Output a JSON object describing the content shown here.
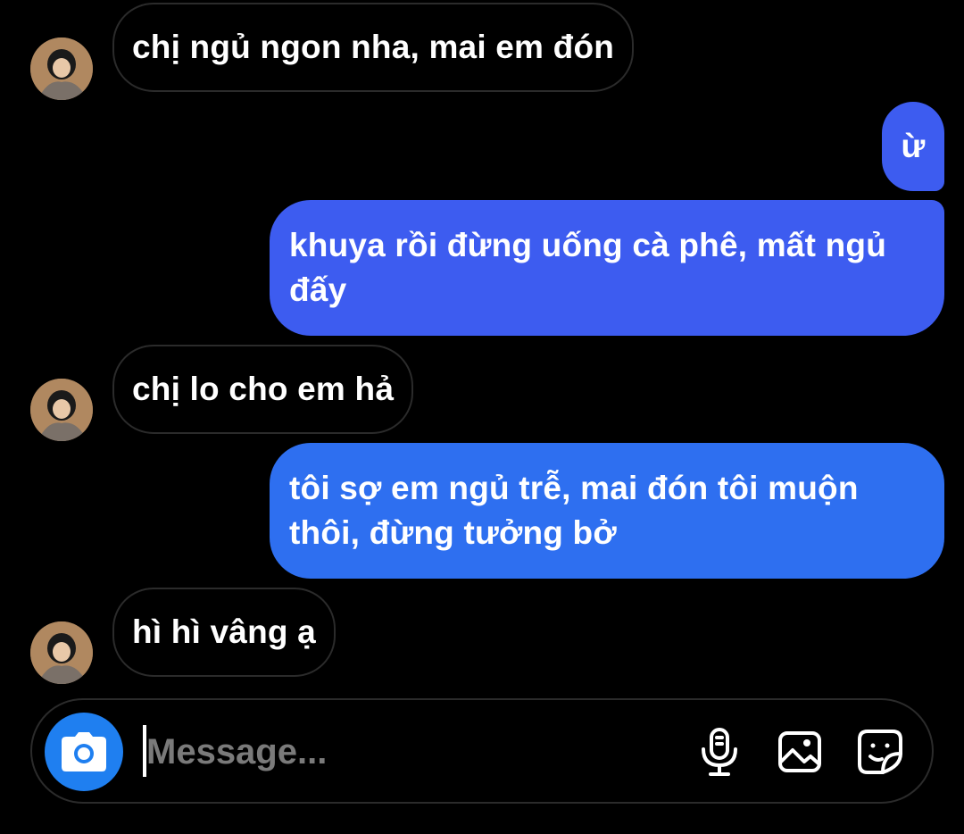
{
  "conversation": {
    "messages": [
      {
        "direction": "incoming",
        "text": "chị ngủ ngon nha, mai em đón"
      },
      {
        "direction": "outgoing",
        "text": "ừ"
      },
      {
        "direction": "outgoing",
        "text": "khuya rồi đừng uống cà phê, mất ngủ đấy"
      },
      {
        "direction": "incoming",
        "text": "chị lo cho em hả"
      },
      {
        "direction": "outgoing",
        "text": "tôi sợ em ngủ trễ, mai đón tôi muộn thôi, đừng tưởng bở"
      },
      {
        "direction": "incoming",
        "text": "hì hì vâng ạ"
      }
    ]
  },
  "composer": {
    "placeholder": "Message...",
    "value": "",
    "icons": [
      "camera-icon",
      "microphone-icon",
      "gallery-icon",
      "sticker-icon"
    ]
  },
  "colors": {
    "outgoing_bubble": "#3d5cf0",
    "camera_button": "#1f7ff0",
    "background": "#000000",
    "incoming_border": "#2b2b2b"
  }
}
